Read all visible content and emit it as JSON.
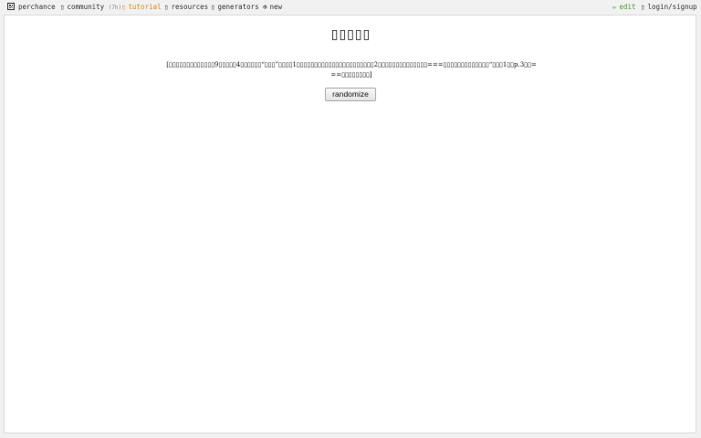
{
  "nav": {
    "brand": "perchance",
    "community": "community",
    "community_count": "(7h)",
    "tutorial": "tutorial",
    "resources": "resources",
    "generators": "generators",
    "new": "new",
    "edit": "edit",
    "login": "login/signup"
  },
  "icons": {
    "brand": "dice-icon",
    "community": "chat-icon",
    "tutorial": "book-icon",
    "resources": "folder-icon",
    "generators": "list-icon",
    "new": "plus-icon",
    "edit": "pencil-icon",
    "login": "user-icon"
  },
  "colors": {
    "tutorial": "#d98a1c",
    "edit": "#4a9a2a",
    "panel_bg": "#ffffff",
    "page_bg": "#f1f1f1"
  },
  "main": {
    "title": "▯▯▯▯▯",
    "output_text": "[▯▯▯▯▯▯▯▯▯▯▯▯▯9▯▯▯▯▯4▯▯▯▯▯▯“▯▯▯”▯▯▯▯1▯▯▯▯▯▯▯▯▯▯▯▯▯▯▯▯▯▯▯▯▯▯2▯▯▯▯▯▯▯▯▯▯▯▯▯▯===▯▯▯▯▯▯▯▯▯▯▯▯▯“▯▯▯1▯▯p.3▯▯===▯▯▯▯▯▯▯▯]",
    "button_label": "randomize"
  }
}
